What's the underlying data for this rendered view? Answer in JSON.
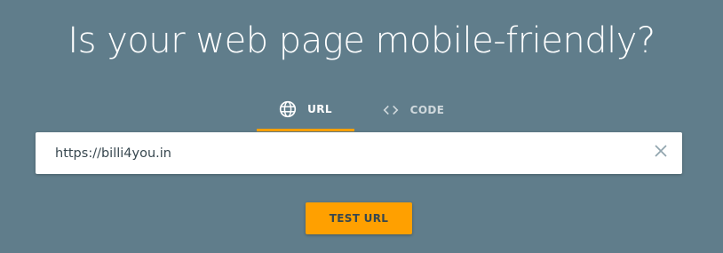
{
  "headline": "Is your web page mobile-friendly?",
  "tabs": [
    {
      "label": "URL",
      "icon": "globe-icon",
      "selected": true
    },
    {
      "label": "CODE",
      "icon": "code-brackets-icon",
      "selected": false
    }
  ],
  "search": {
    "value": "https://billi4you.in",
    "clear_icon": "close-icon"
  },
  "actions": {
    "test_label": "TEST URL"
  },
  "colors": {
    "background": "#607d8b",
    "accent": "#ffa000",
    "text_on_accent": "#37474f",
    "inactive_tab": "#cfd8dc"
  }
}
